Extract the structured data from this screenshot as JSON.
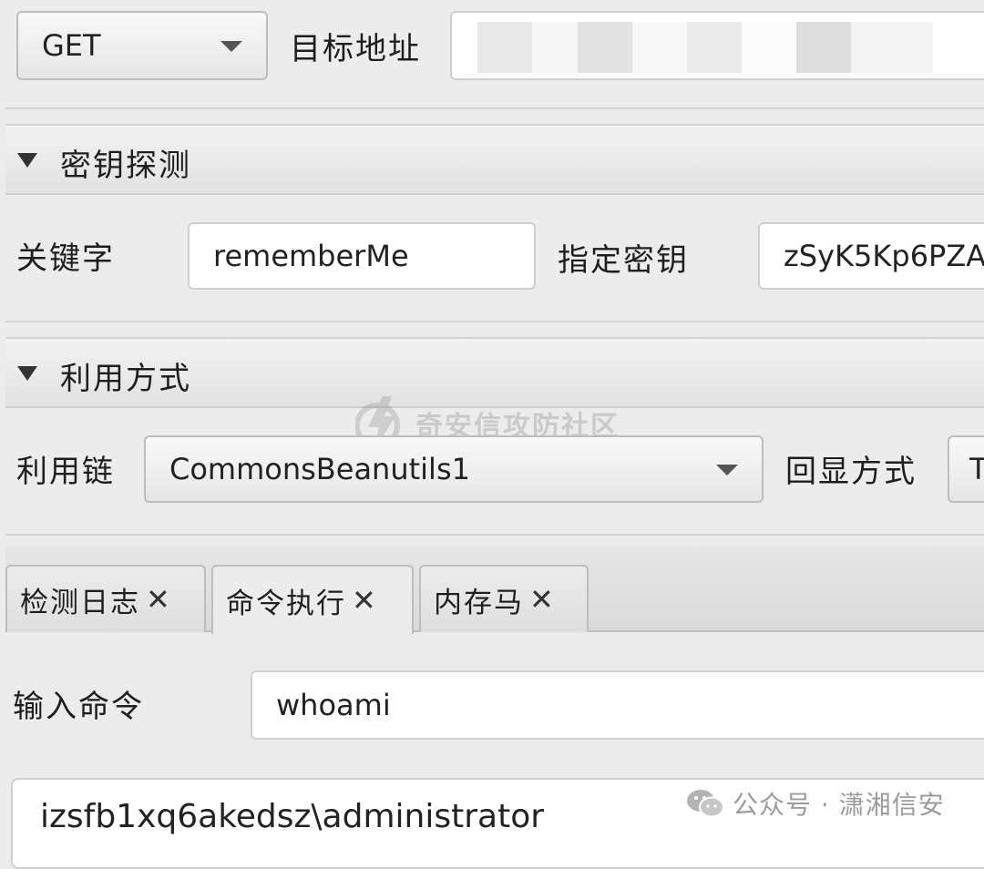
{
  "request": {
    "method": "GET",
    "target_label": "目标地址",
    "target_value": ""
  },
  "key_section": {
    "title": "密钥探测",
    "keyword_label": "关键字",
    "keyword_value": "rememberMe",
    "key_label": "指定密钥",
    "key_value": "zSyK5Kp6PZA"
  },
  "exploit_section": {
    "title": "利用方式",
    "chain_label": "利用链",
    "chain_value": "CommonsBeanutils1",
    "echo_label": "回显方式",
    "echo_value": "T"
  },
  "watermark": {
    "text": "奇安信攻防社区"
  },
  "tabs": [
    {
      "label": "检测日志",
      "close": "✕"
    },
    {
      "label": "命令执行",
      "close": "✕"
    },
    {
      "label": "内存马",
      "close": "✕"
    }
  ],
  "command": {
    "input_label": "输入命令",
    "input_value": "whoami",
    "output": "izsfb1xq6akedsz\\administrator"
  },
  "footer_watermark": {
    "text": "公众号 · 潇湘信安"
  }
}
